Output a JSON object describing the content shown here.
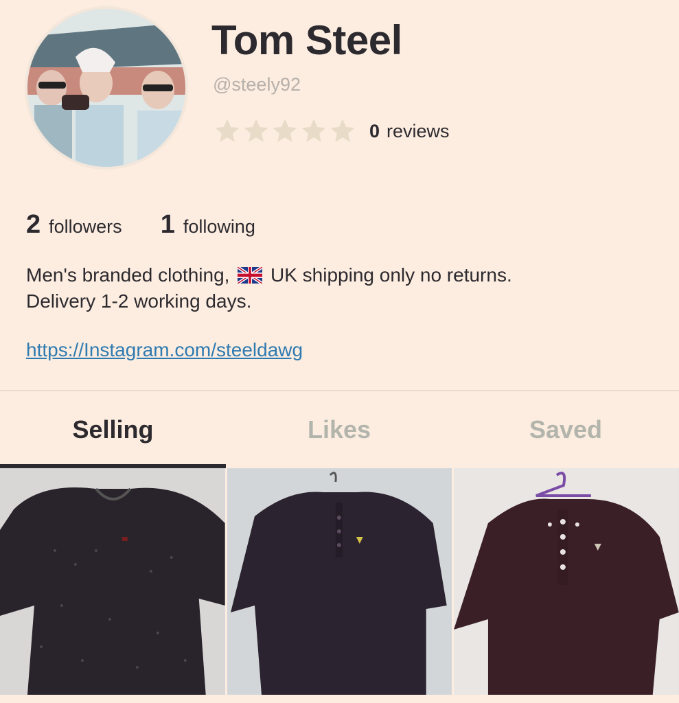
{
  "profile": {
    "name": "Tom Steel",
    "handle": "@steely92",
    "rating": 0,
    "reviews_count": "0",
    "reviews_label": "reviews"
  },
  "stats": {
    "followers_count": "2",
    "followers_label": "followers",
    "following_count": "1",
    "following_label": "following"
  },
  "bio": {
    "line1_before_flag": "Men's branded clothing,",
    "line1_after_flag": "UK shipping only no returns.",
    "line2": "Delivery 1-2 working days.",
    "link": "https://Instagram.com/steeldawg"
  },
  "tabs": [
    {
      "label": "Selling",
      "active": true
    },
    {
      "label": "Likes",
      "active": false
    },
    {
      "label": "Saved",
      "active": false
    }
  ],
  "listings": [
    {
      "item": "black patterned polo shirt"
    },
    {
      "item": "dark long-sleeve polo shirt"
    },
    {
      "item": "burgundy long-sleeve polo shirt"
    }
  ],
  "colors": {
    "background": "#fcede0",
    "text": "#2d2a2f",
    "muted": "#b7b0aa",
    "link": "#2f7ab0",
    "inactive_tab": "#b3b5ac",
    "star_empty": "#e8dcc8"
  }
}
